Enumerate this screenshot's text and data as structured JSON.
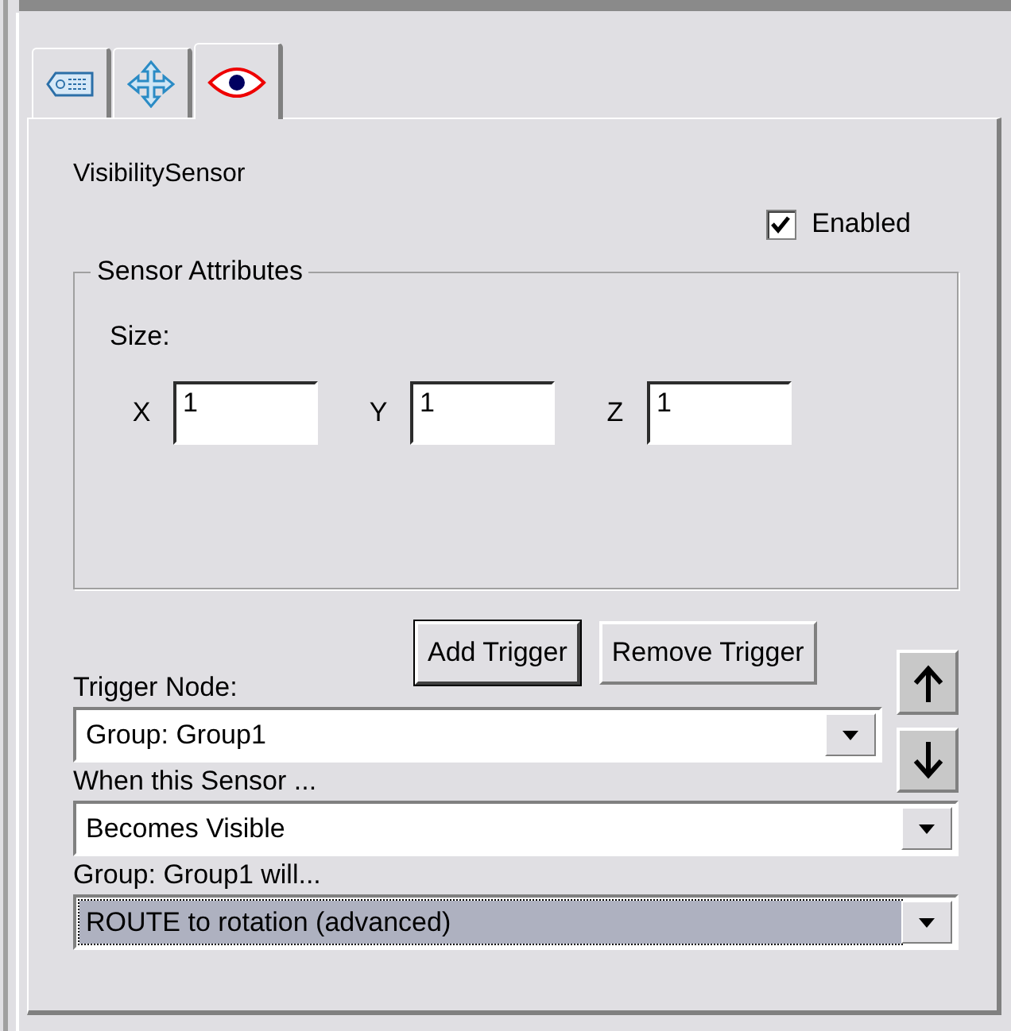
{
  "tabs": [
    {
      "kind": "tag",
      "selected": false
    },
    {
      "kind": "move",
      "selected": false
    },
    {
      "kind": "eye",
      "selected": true
    }
  ],
  "node_title": "VisibilitySensor",
  "enabled": {
    "label": "Enabled",
    "checked": true
  },
  "group": {
    "title": "Sensor Attributes",
    "size_label": "Size:",
    "fields": [
      {
        "label": "X",
        "value": "1"
      },
      {
        "label": "Y",
        "value": "1"
      },
      {
        "label": "Z",
        "value": "1"
      }
    ]
  },
  "buttons": [
    {
      "label": "Add Trigger",
      "default": true
    },
    {
      "label": "Remove Trigger",
      "default": false
    }
  ],
  "arrows": [
    {
      "kind": "up"
    },
    {
      "kind": "down"
    }
  ],
  "combos": [
    {
      "label": "Trigger Node:",
      "value": "Group:  Group1",
      "focused": false
    },
    {
      "label": "When this Sensor ...",
      "value": "Becomes Visible",
      "focused": false
    },
    {
      "label": "Group:  Group1 will...",
      "value": "ROUTE to rotation (advanced)",
      "focused": true
    }
  ]
}
